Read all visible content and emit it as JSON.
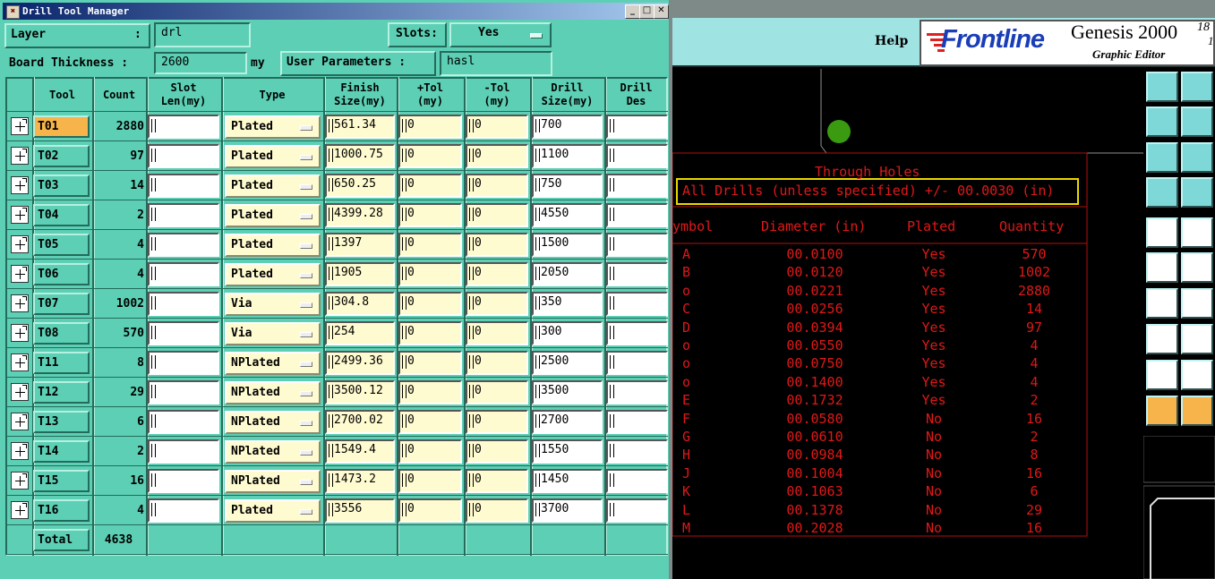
{
  "window": {
    "title": "Drill Tool Manager",
    "layer_label": "Layer",
    "layer_colon": ":",
    "layer_value": "drl",
    "slots_label": "Slots:",
    "slots_value": "Yes",
    "thickness_label": "Board Thickness :",
    "thickness_value": "2600",
    "thickness_unit": "my",
    "user_params_label": "User Parameters :",
    "user_params_value": "hasl"
  },
  "columns": [
    "Tool",
    "Count",
    "Slot\nLen(my)",
    "Type",
    "Finish\nSize(my)",
    "+Tol\n(my)",
    "-Tol\n(my)",
    "Drill\nSize(my)",
    "Drill\nDes"
  ],
  "rows": [
    {
      "tool": "T01",
      "count": "2880",
      "type": "Plated",
      "finish": "561.34",
      "ptol": "0",
      "ntol": "0",
      "drill": "700"
    },
    {
      "tool": "T02",
      "count": "97",
      "type": "Plated",
      "finish": "1000.75",
      "ptol": "0",
      "ntol": "0",
      "drill": "1100"
    },
    {
      "tool": "T03",
      "count": "14",
      "type": "Plated",
      "finish": "650.25",
      "ptol": "0",
      "ntol": "0",
      "drill": "750"
    },
    {
      "tool": "T04",
      "count": "2",
      "type": "Plated",
      "finish": "4399.28",
      "ptol": "0",
      "ntol": "0",
      "drill": "4550"
    },
    {
      "tool": "T05",
      "count": "4",
      "type": "Plated",
      "finish": "1397",
      "ptol": "0",
      "ntol": "0",
      "drill": "1500"
    },
    {
      "tool": "T06",
      "count": "4",
      "type": "Plated",
      "finish": "1905",
      "ptol": "0",
      "ntol": "0",
      "drill": "2050"
    },
    {
      "tool": "T07",
      "count": "1002",
      "type": "Via",
      "finish": "304.8",
      "ptol": "0",
      "ntol": "0",
      "drill": "350"
    },
    {
      "tool": "T08",
      "count": "570",
      "type": "Via",
      "finish": "254",
      "ptol": "0",
      "ntol": "0",
      "drill": "300"
    },
    {
      "tool": "T11",
      "count": "8",
      "type": "NPlated",
      "finish": "2499.36",
      "ptol": "0",
      "ntol": "0",
      "drill": "2500"
    },
    {
      "tool": "T12",
      "count": "29",
      "type": "NPlated",
      "finish": "3500.12",
      "ptol": "0",
      "ntol": "0",
      "drill": "3500"
    },
    {
      "tool": "T13",
      "count": "6",
      "type": "NPlated",
      "finish": "2700.02",
      "ptol": "0",
      "ntol": "0",
      "drill": "2700"
    },
    {
      "tool": "T14",
      "count": "2",
      "type": "NPlated",
      "finish": "1549.4",
      "ptol": "0",
      "ntol": "0",
      "drill": "1550"
    },
    {
      "tool": "T15",
      "count": "16",
      "type": "NPlated",
      "finish": "1473.2",
      "ptol": "0",
      "ntol": "0",
      "drill": "1450"
    },
    {
      "tool": "T16",
      "count": "4",
      "type": "Plated",
      "finish": "3556",
      "ptol": "0",
      "ntol": "0",
      "drill": "3700"
    }
  ],
  "total": {
    "label": "Total",
    "count": "4638"
  },
  "editor": {
    "help": "Help",
    "brand": "Frontline",
    "product": "Genesis 2000",
    "subtitle": "Graphic Editor",
    "version_top": "18",
    "version_bottom": "1"
  },
  "drill_table": {
    "title": "Through Holes",
    "note": "All Drills (unless specified) +/- 00.0030 (in)",
    "headers": [
      "ymbol",
      "Diameter (in)",
      "Plated",
      "Quantity"
    ],
    "rows": [
      [
        "A",
        "00.0100",
        "Yes",
        "570"
      ],
      [
        "B",
        "00.0120",
        "Yes",
        "1002"
      ],
      [
        "o",
        "00.0221",
        "Yes",
        "2880"
      ],
      [
        "C",
        "00.0256",
        "Yes",
        "14"
      ],
      [
        "D",
        "00.0394",
        "Yes",
        "97"
      ],
      [
        "o",
        "00.0550",
        "Yes",
        "4"
      ],
      [
        "o",
        "00.0750",
        "Yes",
        "4"
      ],
      [
        "o",
        "00.1400",
        "Yes",
        "4"
      ],
      [
        "E",
        "00.1732",
        "Yes",
        "2"
      ],
      [
        "F",
        "00.0580",
        "No",
        "16"
      ],
      [
        "G",
        "00.0610",
        "No",
        "2"
      ],
      [
        "H",
        "00.0984",
        "No",
        "8"
      ],
      [
        "J",
        "00.1004",
        "No",
        "16"
      ],
      [
        "K",
        "00.1063",
        "No",
        "6"
      ],
      [
        "L",
        "00.1378",
        "No",
        "29"
      ],
      [
        "M",
        "00.2028",
        "No",
        "16"
      ]
    ]
  },
  "icons": [
    "restore-icon",
    "minimize-icon",
    "close-icon",
    "dropdown-icon",
    "expand-plus-icon",
    "frontline-logo-icon",
    "green-pad-icon"
  ],
  "colors": {
    "panel": "#5ccfb4",
    "selected_tool": "#f7b44a",
    "red_text": "#e01818",
    "note_border": "#e8d800",
    "editor_bar": "#9fe3e2"
  }
}
